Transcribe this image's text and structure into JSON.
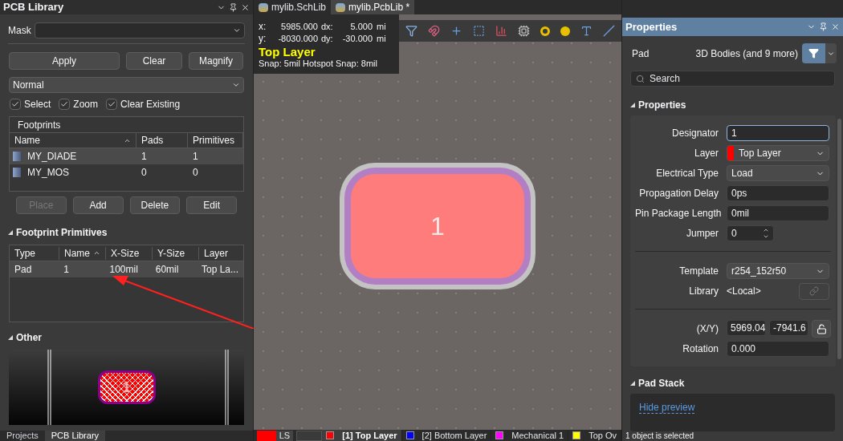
{
  "left_panel": {
    "title": "PCB Library",
    "mask": {
      "label": "Mask"
    },
    "buttons": [
      "Apply",
      "Clear",
      "Magnify"
    ],
    "mode_dropdown": {
      "value": "Normal"
    },
    "options": [
      {
        "label": "Select",
        "checked": true
      },
      {
        "label": "Zoom",
        "checked": true
      },
      {
        "label": "Clear Existing",
        "checked": true
      }
    ],
    "footprints": {
      "title": "Footprints",
      "columns": [
        {
          "label": "Name",
          "sorted": true
        },
        {
          "label": "Pads",
          "sorted": false
        },
        {
          "label": "Primitives",
          "sorted": false
        }
      ],
      "rows": [
        {
          "name": "MY_DIADE",
          "pads": "1",
          "primitives": "1",
          "selected": true
        },
        {
          "name": "MY_MOS",
          "pads": "0",
          "primitives": "0",
          "selected": false
        }
      ]
    },
    "footprint_buttons": [
      {
        "label": "Place",
        "disabled": true
      },
      {
        "label": "Add",
        "disabled": false
      },
      {
        "label": "Delete",
        "disabled": false
      },
      {
        "label": "Edit",
        "disabled": false
      }
    ],
    "primitives": {
      "title": "Footprint Primitives",
      "columns": [
        {
          "label": "Type",
          "sorted": false
        },
        {
          "label": "Name",
          "sorted": true
        },
        {
          "label": "X-Size",
          "sorted": false
        },
        {
          "label": "Y-Size",
          "sorted": false
        },
        {
          "label": "Layer",
          "sorted": false
        }
      ],
      "rows": [
        {
          "cells": [
            "Pad",
            "1",
            "100mil",
            "60mil",
            "Top La..."
          ],
          "selected": true
        }
      ]
    },
    "other": {
      "title": "Other",
      "pad_label": "1"
    },
    "bottom_tabs": [
      {
        "label": "Projects",
        "selected": false
      },
      {
        "label": "PCB Library",
        "selected": true
      }
    ]
  },
  "canvas": {
    "document_tabs": [
      {
        "label": "mylib.SchLib",
        "selected": false
      },
      {
        "label": "mylib.PcbLib *",
        "selected": true
      }
    ],
    "coordinates": [
      {
        "axis": "x:",
        "value": "5985.000",
        "delta_label": "dx:",
        "delta": "5.000",
        "unit": "mi"
      },
      {
        "axis": "y:",
        "value": "-8030.000",
        "delta_label": "dy:",
        "delta": "-30.000",
        "unit": "mi"
      }
    ],
    "layer_name": "Top Layer",
    "snap": "Snap: 5mil Hotspot Snap: 8mil",
    "pad_label": "1",
    "layer_bar": {
      "current_layer": {
        "color": "#ff0000"
      },
      "ls": "LS",
      "layers": [
        {
          "label": "[1] Top Layer",
          "color": "#ff0000",
          "selected": true
        },
        {
          "label": "[2] Bottom Layer",
          "color": "#0000ff",
          "selected": false
        },
        {
          "label": "Mechanical 1",
          "color": "#ff00ff",
          "selected": false
        },
        {
          "label": "Top Ov",
          "color": "#ffff00",
          "selected": false
        }
      ]
    }
  },
  "right_panel": {
    "title": "Properties",
    "object": "Pad",
    "filter_summary": "3D Bodies (and 9 more)",
    "search": {
      "placeholder": "Search"
    },
    "section": "Properties",
    "field_groups": [
      [
        {
          "kind": "input",
          "label": "Designator",
          "value": "1",
          "focused": true
        },
        {
          "kind": "layer",
          "label": "Layer",
          "value": "Top Layer",
          "color": "#ff0000"
        },
        {
          "kind": "dropdown",
          "label": "Electrical Type",
          "value": "Load"
        },
        {
          "kind": "input",
          "label": "Propagation Delay",
          "value": "0ps",
          "focused": false
        },
        {
          "kind": "input",
          "label": "Pin Package Length",
          "value": "0mil",
          "focused": false
        },
        {
          "kind": "spinner",
          "label": "Jumper",
          "value": "0"
        }
      ],
      [
        {
          "kind": "dropdown",
          "label": "Template",
          "value": "r254_152r50"
        },
        {
          "kind": "text",
          "label": "Library",
          "value": "<Local>"
        }
      ],
      [
        {
          "kind": "xy",
          "label": "(X/Y)",
          "values": [
            "5969.04",
            "-7941.6"
          ]
        },
        {
          "kind": "input",
          "label": "Rotation",
          "value": "0.000",
          "focused": false
        }
      ]
    ],
    "pad_stack": {
      "title": "Pad Stack",
      "link": "Hide preview"
    },
    "status": "1 object is selected"
  }
}
